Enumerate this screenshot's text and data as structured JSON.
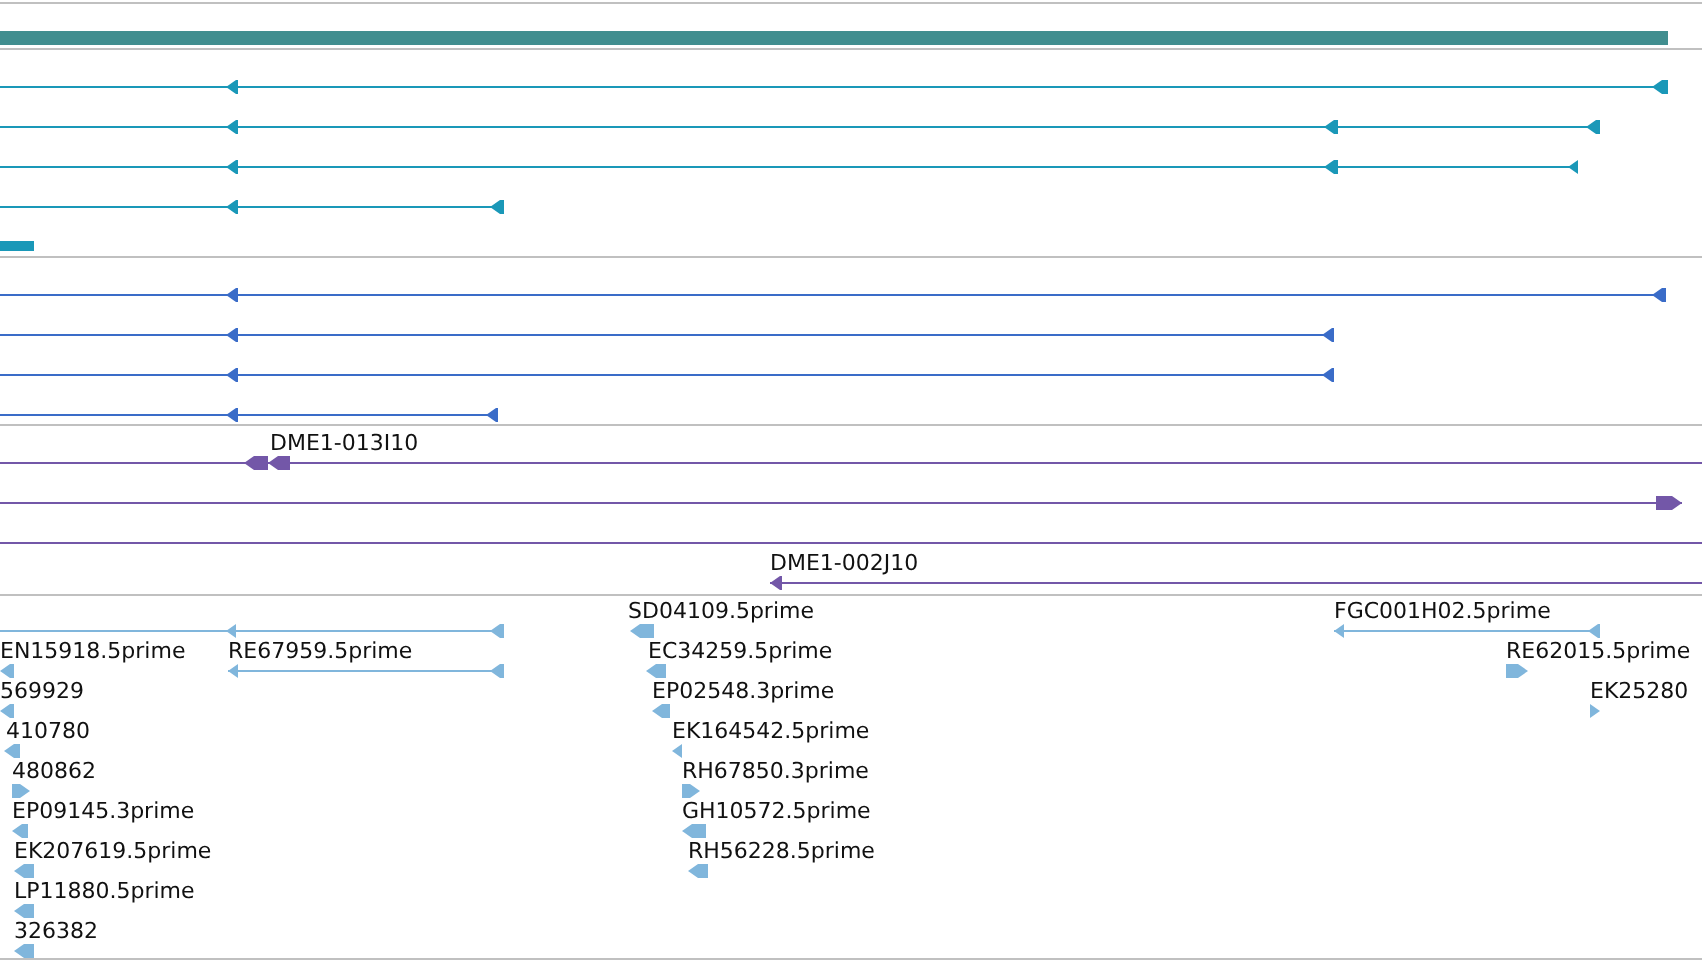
{
  "tracks": [
    {
      "color": "#418e8f",
      "features": [
        {
          "kind": "block"
        }
      ]
    },
    {
      "color": "#1a98b8",
      "features": [
        {
          "kind": "transcript",
          "reverse": true
        },
        {
          "kind": "transcript",
          "reverse": true
        },
        {
          "kind": "transcript",
          "reverse": true
        },
        {
          "kind": "transcript",
          "reverse": true
        },
        {
          "kind": "block"
        }
      ]
    },
    {
      "color": "#3a6cc8",
      "features": [
        {
          "kind": "transcript",
          "reverse": true
        },
        {
          "kind": "transcript",
          "reverse": true
        },
        {
          "kind": "transcript",
          "reverse": true
        },
        {
          "kind": "transcript",
          "reverse": true
        }
      ]
    },
    {
      "color": "#7357a8",
      "features": [
        {
          "kind": "transcript",
          "reverse": true,
          "label": "DME1-013I10"
        },
        {
          "kind": "transcript",
          "reverse": false
        },
        {
          "kind": "transcript"
        },
        {
          "kind": "transcript",
          "reverse": true,
          "label": "DME1-002J10"
        }
      ]
    },
    {
      "color": "#80b6dc",
      "features": [
        {
          "kind": "transcript",
          "reverse": true
        },
        {
          "kind": "transcript",
          "reverse": true,
          "label": "SD04109.5prime"
        },
        {
          "kind": "transcript",
          "reverse": true,
          "label": "FGC001H02.5prime"
        },
        {
          "kind": "transcript",
          "reverse": true,
          "label": "EN15918.5prime"
        },
        {
          "kind": "transcript",
          "reverse": true,
          "label": "RE67959.5prime"
        },
        {
          "kind": "transcript",
          "reverse": true,
          "label": "EC34259.5prime"
        },
        {
          "kind": "transcript",
          "reverse": false,
          "label": "RE62015.5prime"
        },
        {
          "kind": "transcript",
          "reverse": true,
          "label": "569929"
        },
        {
          "kind": "transcript",
          "reverse": true,
          "label": "EP02548.3prime"
        },
        {
          "kind": "transcript",
          "reverse": false,
          "label": "EK25280"
        },
        {
          "kind": "transcript",
          "reverse": true,
          "label": "410780"
        },
        {
          "kind": "transcript",
          "reverse": true,
          "label": "EK164542.5prime"
        },
        {
          "kind": "transcript",
          "reverse": false,
          "label": "480862"
        },
        {
          "kind": "transcript",
          "reverse": false,
          "label": "RH67850.3prime"
        },
        {
          "kind": "transcript",
          "reverse": true,
          "label": "EP09145.3prime"
        },
        {
          "kind": "transcript",
          "reverse": true,
          "label": "GH10572.5prime"
        },
        {
          "kind": "transcript",
          "reverse": true,
          "label": "EK207619.5prime"
        },
        {
          "kind": "transcript",
          "reverse": true,
          "label": "RH56228.5prime"
        },
        {
          "kind": "transcript",
          "reverse": true,
          "label": "LP11880.5prime"
        },
        {
          "kind": "transcript",
          "reverse": true,
          "label": "326382"
        }
      ]
    }
  ]
}
